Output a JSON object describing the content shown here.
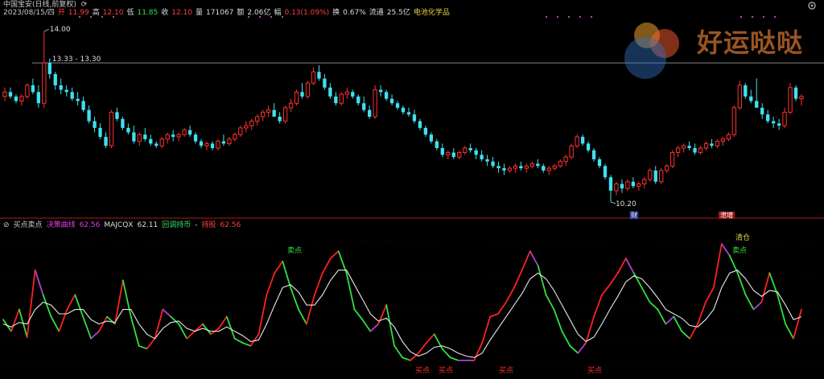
{
  "header": {
    "line1": {
      "name": "中国宝安(日线,前复权)",
      "icon": "refresh-icon"
    },
    "line2": {
      "date": "2023/08/15/四",
      "open_label": "开",
      "open_value": "11.99",
      "high_label": "高",
      "high_value": "12.10",
      "low_label": "低",
      "low_value": "11.85",
      "close_label": "收",
      "close_value": "12.10",
      "volume_label": "量",
      "volume_value": "171067",
      "amount_label": "额",
      "amount_value": "2.06亿",
      "change_label": "幅",
      "change_value": "0.13(1.09%)",
      "turnover_label": "换",
      "turnover_value": "0.67%",
      "float_label": "流通",
      "float_value": "25.5亿",
      "sector": "电池化学品"
    }
  },
  "annotations": {
    "high_label": "14.00",
    "range_label": "13.33 - 13.30",
    "low_label": "10.20",
    "badge_cai": "财",
    "badge_tuijian": "泄增"
  },
  "indicator_header": {
    "name": "买点卖点",
    "decision_label": "决策曲线",
    "decision_value": "62.56",
    "majcqx_label": "MAJCQX",
    "majcqx_value": "62.11",
    "pullback_label": "回调持币",
    "hold_label": "持股",
    "hold_value": "62.56"
  },
  "signals": {
    "sell": "卖点",
    "buy": "买点",
    "clear": "清仓"
  },
  "watermark": {
    "text": "好运哒哒"
  },
  "colors": {
    "up": "#ff3030",
    "down": "#40e0f0",
    "line_white": "#f0f0f0",
    "ind_red": "#ff2020",
    "ind_green": "#30e040",
    "ind_purple": "#b040d0",
    "ind_white": "#e8e8e8",
    "divider": "#b01818"
  },
  "chart_data": [
    {
      "type": "candlestick",
      "x_label": "",
      "y_label": "",
      "ylim": [
        10.0,
        14.2
      ],
      "ref_line": 13.3,
      "ohlc": [
        [
          12.55,
          12.75,
          12.45,
          12.65
        ],
        [
          12.65,
          12.75,
          12.5,
          12.55
        ],
        [
          12.55,
          12.6,
          12.4,
          12.45
        ],
        [
          12.45,
          12.6,
          12.35,
          12.55
        ],
        [
          12.55,
          12.85,
          12.5,
          12.8
        ],
        [
          12.8,
          12.95,
          12.6,
          12.65
        ],
        [
          12.65,
          12.8,
          12.3,
          12.4
        ],
        [
          12.4,
          14.0,
          12.3,
          13.3
        ],
        [
          13.3,
          13.4,
          12.95,
          13.05
        ],
        [
          13.05,
          13.1,
          12.7,
          12.8
        ],
        [
          12.8,
          12.95,
          12.6,
          12.7
        ],
        [
          12.7,
          12.8,
          12.55,
          12.65
        ],
        [
          12.65,
          12.75,
          12.45,
          12.5
        ],
        [
          12.5,
          12.65,
          12.35,
          12.45
        ],
        [
          12.45,
          12.55,
          12.2,
          12.25
        ],
        [
          12.25,
          12.35,
          11.95,
          12.0
        ],
        [
          12.0,
          12.1,
          11.75,
          11.85
        ],
        [
          11.85,
          11.95,
          11.6,
          11.65
        ],
        [
          11.65,
          11.75,
          11.4,
          11.45
        ],
        [
          11.45,
          12.25,
          11.4,
          12.2
        ],
        [
          12.2,
          12.3,
          12.0,
          12.05
        ],
        [
          12.05,
          12.1,
          11.8,
          11.85
        ],
        [
          11.85,
          11.95,
          11.7,
          11.75
        ],
        [
          11.75,
          11.9,
          11.5,
          11.55
        ],
        [
          11.55,
          11.75,
          11.45,
          11.7
        ],
        [
          11.7,
          11.85,
          11.55,
          11.6
        ],
        [
          11.6,
          11.7,
          11.45,
          11.5
        ],
        [
          11.5,
          11.55,
          11.4,
          11.45
        ],
        [
          11.45,
          11.65,
          11.4,
          11.6
        ],
        [
          11.6,
          11.75,
          11.5,
          11.7
        ],
        [
          11.7,
          11.8,
          11.55,
          11.65
        ],
        [
          11.65,
          11.75,
          11.55,
          11.7
        ],
        [
          11.7,
          11.85,
          11.65,
          11.8
        ],
        [
          11.8,
          11.9,
          11.65,
          11.7
        ],
        [
          11.7,
          11.75,
          11.5,
          11.55
        ],
        [
          11.55,
          11.6,
          11.4,
          11.45
        ],
        [
          11.45,
          11.55,
          11.35,
          11.5
        ],
        [
          11.5,
          11.55,
          11.35,
          11.4
        ],
        [
          11.4,
          11.6,
          11.35,
          11.55
        ],
        [
          11.55,
          11.7,
          11.45,
          11.5
        ],
        [
          11.5,
          11.65,
          11.45,
          11.6
        ],
        [
          11.6,
          11.75,
          11.55,
          11.7
        ],
        [
          11.7,
          11.9,
          11.65,
          11.85
        ],
        [
          11.85,
          12.0,
          11.75,
          11.9
        ],
        [
          11.9,
          12.05,
          11.8,
          12.0
        ],
        [
          12.0,
          12.15,
          11.9,
          12.1
        ],
        [
          12.1,
          12.25,
          12.0,
          12.2
        ],
        [
          12.2,
          12.35,
          12.1,
          12.25
        ],
        [
          12.25,
          12.4,
          12.15,
          12.1
        ],
        [
          12.1,
          12.2,
          11.95,
          12.0
        ],
        [
          12.0,
          12.35,
          11.95,
          12.3
        ],
        [
          12.3,
          12.5,
          12.2,
          12.4
        ],
        [
          12.4,
          12.7,
          12.35,
          12.65
        ],
        [
          12.65,
          12.85,
          12.5,
          12.55
        ],
        [
          12.55,
          12.9,
          12.5,
          12.85
        ],
        [
          12.85,
          13.2,
          12.8,
          13.1
        ],
        [
          13.1,
          13.25,
          12.9,
          12.95
        ],
        [
          12.95,
          13.05,
          12.7,
          12.75
        ],
        [
          12.75,
          12.85,
          12.5,
          12.55
        ],
        [
          12.55,
          12.65,
          12.35,
          12.4
        ],
        [
          12.4,
          12.65,
          12.35,
          12.6
        ],
        [
          12.6,
          12.75,
          12.5,
          12.65
        ],
        [
          12.65,
          12.7,
          12.5,
          12.55
        ],
        [
          12.55,
          12.6,
          12.35,
          12.4
        ],
        [
          12.4,
          12.55,
          12.2,
          12.25
        ],
        [
          12.25,
          12.35,
          12.05,
          12.1
        ],
        [
          12.1,
          12.8,
          12.05,
          12.7
        ],
        [
          12.7,
          12.8,
          12.55,
          12.65
        ],
        [
          12.65,
          12.7,
          12.45,
          12.5
        ],
        [
          12.5,
          12.6,
          12.35,
          12.4
        ],
        [
          12.4,
          12.45,
          12.25,
          12.3
        ],
        [
          12.3,
          12.35,
          12.15,
          12.2
        ],
        [
          12.2,
          12.3,
          12.1,
          12.15
        ],
        [
          12.15,
          12.25,
          11.95,
          12.0
        ],
        [
          12.0,
          12.05,
          11.8,
          11.85
        ],
        [
          11.85,
          11.9,
          11.65,
          11.7
        ],
        [
          11.7,
          11.75,
          11.5,
          11.55
        ],
        [
          11.55,
          11.6,
          11.35,
          11.4
        ],
        [
          11.4,
          11.5,
          11.2,
          11.25
        ],
        [
          11.25,
          11.35,
          11.15,
          11.3
        ],
        [
          11.3,
          11.4,
          11.15,
          11.2
        ],
        [
          11.2,
          11.35,
          11.15,
          11.3
        ],
        [
          11.3,
          11.45,
          11.25,
          11.4
        ],
        [
          11.4,
          11.5,
          11.3,
          11.35
        ],
        [
          11.35,
          11.4,
          11.15,
          11.25
        ],
        [
          11.25,
          11.35,
          11.1,
          11.15
        ],
        [
          11.15,
          11.25,
          11.0,
          11.1
        ],
        [
          11.1,
          11.2,
          10.95,
          11.0
        ],
        [
          11.0,
          11.1,
          10.85,
          10.95
        ],
        [
          10.95,
          11.05,
          10.8,
          10.9
        ],
        [
          10.9,
          11.0,
          10.85,
          10.95
        ],
        [
          10.95,
          11.05,
          10.85,
          11.0
        ],
        [
          11.0,
          11.1,
          10.9,
          10.95
        ],
        [
          10.95,
          11.05,
          10.85,
          11.0
        ],
        [
          11.0,
          11.1,
          10.95,
          11.05
        ],
        [
          11.05,
          11.15,
          10.95,
          11.0
        ],
        [
          11.0,
          11.05,
          10.85,
          10.9
        ],
        [
          10.9,
          11.0,
          10.8,
          10.95
        ],
        [
          10.95,
          11.05,
          10.9,
          11.0
        ],
        [
          11.0,
          11.15,
          10.95,
          11.1
        ],
        [
          11.1,
          11.25,
          11.0,
          11.2
        ],
        [
          11.2,
          11.5,
          11.15,
          11.45
        ],
        [
          11.45,
          11.7,
          11.4,
          11.65
        ],
        [
          11.65,
          11.7,
          11.45,
          11.5
        ],
        [
          11.5,
          11.55,
          11.3,
          11.35
        ],
        [
          11.35,
          11.4,
          11.1,
          11.15
        ],
        [
          11.15,
          11.2,
          10.95,
          11.0
        ],
        [
          11.0,
          11.05,
          10.7,
          10.75
        ],
        [
          10.75,
          10.8,
          10.2,
          10.45
        ],
        [
          10.45,
          10.65,
          10.35,
          10.6
        ],
        [
          10.6,
          10.7,
          10.4,
          10.5
        ],
        [
          10.5,
          10.7,
          10.45,
          10.65
        ],
        [
          10.65,
          10.75,
          10.5,
          10.55
        ],
        [
          10.55,
          10.65,
          10.45,
          10.6
        ],
        [
          10.6,
          10.75,
          10.5,
          10.7
        ],
        [
          10.7,
          10.95,
          10.65,
          10.9
        ],
        [
          10.9,
          11.0,
          10.6,
          10.65
        ],
        [
          10.65,
          10.95,
          10.6,
          10.9
        ],
        [
          10.9,
          11.05,
          10.85,
          11.0
        ],
        [
          11.0,
          11.35,
          10.95,
          11.3
        ],
        [
          11.3,
          11.45,
          11.2,
          11.4
        ],
        [
          11.4,
          11.5,
          11.3,
          11.45
        ],
        [
          11.45,
          11.55,
          11.35,
          11.4
        ],
        [
          11.4,
          11.5,
          11.25,
          11.3
        ],
        [
          11.3,
          11.45,
          11.25,
          11.4
        ],
        [
          11.4,
          11.55,
          11.35,
          11.5
        ],
        [
          11.5,
          11.6,
          11.4,
          11.45
        ],
        [
          11.45,
          11.6,
          11.4,
          11.55
        ],
        [
          11.55,
          11.65,
          11.45,
          11.6
        ],
        [
          11.6,
          11.75,
          11.55,
          11.7
        ],
        [
          11.7,
          12.35,
          11.65,
          12.3
        ],
        [
          12.3,
          12.9,
          12.25,
          12.8
        ],
        [
          12.8,
          12.85,
          12.5,
          12.55
        ],
        [
          12.55,
          12.7,
          12.4,
          12.45
        ],
        [
          12.45,
          12.95,
          12.4,
          12.3
        ],
        [
          12.3,
          12.4,
          12.05,
          12.15
        ],
        [
          12.15,
          12.25,
          11.95,
          12.0
        ],
        [
          12.0,
          12.1,
          11.85,
          11.95
        ],
        [
          11.95,
          12.05,
          11.8,
          11.9
        ],
        [
          11.9,
          12.3,
          11.85,
          12.2
        ],
        [
          12.2,
          12.85,
          12.15,
          12.75
        ],
        [
          12.75,
          12.8,
          12.45,
          12.5
        ],
        [
          12.5,
          12.6,
          12.35,
          12.55
        ]
      ]
    },
    {
      "type": "line",
      "x_label": "",
      "y_label": "",
      "ylim": [
        0,
        100
      ],
      "series": [
        {
          "name": "决策曲线",
          "values": [
            38,
            30,
            45,
            26,
            72,
            55,
            40,
            30,
            45,
            55,
            40,
            25,
            30,
            40,
            35,
            65,
            40,
            20,
            18,
            25,
            45,
            40,
            35,
            25,
            30,
            35,
            28,
            32,
            40,
            25,
            22,
            20,
            28,
            55,
            70,
            78,
            60,
            45,
            35,
            55,
            70,
            80,
            85,
            70,
            45,
            38,
            30,
            35,
            48,
            20,
            12,
            10,
            15,
            22,
            28,
            18,
            12,
            10,
            10,
            10,
            22,
            40,
            42,
            50,
            60,
            72,
            85,
            75,
            55,
            45,
            30,
            20,
            15,
            22,
            40,
            55,
            62,
            70,
            80,
            70,
            60,
            50,
            45,
            35,
            40,
            30,
            25,
            35,
            50,
            60,
            90,
            82,
            70,
            55,
            45,
            50,
            70,
            55,
            35,
            25,
            45
          ]
        },
        {
          "name": "MAJCQX",
          "values": [
            35,
            33,
            36,
            35,
            45,
            50,
            48,
            42,
            42,
            45,
            45,
            38,
            35,
            37,
            36,
            45,
            45,
            35,
            28,
            25,
            32,
            36,
            37,
            32,
            30,
            32,
            30,
            30,
            33,
            30,
            27,
            23,
            24,
            35,
            48,
            60,
            62,
            57,
            48,
            48,
            55,
            65,
            72,
            72,
            62,
            52,
            42,
            37,
            39,
            33,
            23,
            16,
            13,
            15,
            19,
            20,
            18,
            15,
            13,
            12,
            15,
            24,
            32,
            40,
            48,
            56,
            66,
            70,
            66,
            58,
            48,
            38,
            28,
            23,
            26,
            35,
            45,
            54,
            64,
            68,
            66,
            60,
            53,
            45,
            42,
            39,
            34,
            33,
            38,
            45,
            60,
            70,
            72,
            66,
            58,
            54,
            58,
            57,
            48,
            38,
            40
          ]
        }
      ]
    }
  ]
}
